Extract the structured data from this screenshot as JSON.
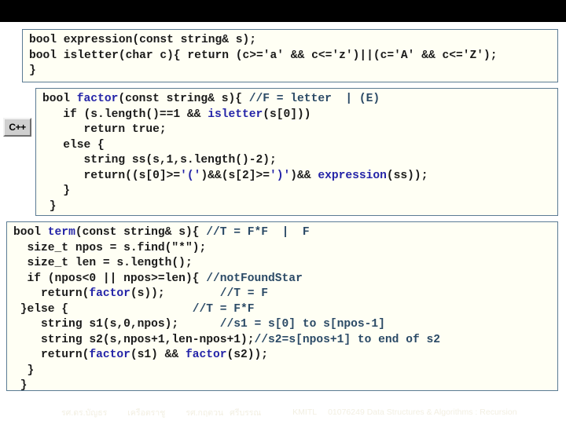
{
  "slide": {
    "badge_label": "C++",
    "boxes": [
      {
        "name": "expression-declarations",
        "lines": [
          [
            {
              "t": "bool expression(const string& s);",
              "c": "plain"
            }
          ],
          [
            {
              "t": "bool isletter(char c){ return (c>='a' && c<='z')||(c='A' && c<='Z');",
              "c": "plain"
            }
          ],
          [
            {
              "t": "}",
              "c": "plain"
            }
          ]
        ]
      },
      {
        "name": "factor-function",
        "lines": [
          [
            {
              "t": "bool ",
              "c": "plain"
            },
            {
              "t": "factor",
              "c": "fn"
            },
            {
              "t": "(const string& s){ ",
              "c": "plain"
            },
            {
              "t": "//F = letter  | (E)",
              "c": "cmt"
            }
          ],
          [
            {
              "t": "   if (s.length()==1 && ",
              "c": "plain"
            },
            {
              "t": "isletter",
              "c": "fn"
            },
            {
              "t": "(s[0]))",
              "c": "plain"
            }
          ],
          [
            {
              "t": "      return true;",
              "c": "plain"
            }
          ],
          [
            {
              "t": "   else {",
              "c": "plain"
            }
          ],
          [
            {
              "t": "      string ss(s,1,s.length()-2);",
              "c": "plain"
            }
          ],
          [
            {
              "t": "      return((s[0]>=",
              "c": "plain"
            },
            {
              "t": "'('",
              "c": "lit"
            },
            {
              "t": ")&&(s[2]>=",
              "c": "plain"
            },
            {
              "t": "')'",
              "c": "lit"
            },
            {
              "t": ")&& ",
              "c": "plain"
            },
            {
              "t": "expression",
              "c": "fn"
            },
            {
              "t": "(ss));",
              "c": "plain"
            }
          ],
          [
            {
              "t": "   }",
              "c": "plain"
            }
          ],
          [
            {
              "t": " }",
              "c": "plain"
            }
          ]
        ]
      },
      {
        "name": "term-function",
        "lines": [
          [
            {
              "t": "bool ",
              "c": "plain"
            },
            {
              "t": "term",
              "c": "fn"
            },
            {
              "t": "(const string& s){ ",
              "c": "plain"
            },
            {
              "t": "//T = F*F  |  F",
              "c": "cmt"
            }
          ],
          [
            {
              "t": "  size_t npos = s.find(\"*\");",
              "c": "plain"
            }
          ],
          [
            {
              "t": "  size_t len = s.length();",
              "c": "plain"
            }
          ],
          [
            {
              "t": "  if (npos<0 || npos>=len){ ",
              "c": "plain"
            },
            {
              "t": "//notFoundStar",
              "c": "cmt"
            }
          ],
          [
            {
              "t": "    return(",
              "c": "plain"
            },
            {
              "t": "factor",
              "c": "fn"
            },
            {
              "t": "(s));",
              "c": "plain"
            },
            {
              "t": "        ",
              "c": "plain"
            },
            {
              "t": "//T = F",
              "c": "cmt"
            }
          ],
          [
            {
              "t": " }else {",
              "c": "plain"
            },
            {
              "t": "                  ",
              "c": "plain"
            },
            {
              "t": "//T = F*F",
              "c": "cmt"
            }
          ],
          [
            {
              "t": "    string s1(s,0,npos);",
              "c": "plain"
            },
            {
              "t": "      ",
              "c": "plain"
            },
            {
              "t": "//s1 = s[0] to s[npos-1]",
              "c": "cmt"
            }
          ],
          [
            {
              "t": "    string s2(s,npos+1,len-npos+1);",
              "c": "plain"
            },
            {
              "t": "//s2=s[npos+1] to end of s2",
              "c": "cmt"
            }
          ],
          [
            {
              "t": "    return(",
              "c": "plain"
            },
            {
              "t": "factor",
              "c": "fn"
            },
            {
              "t": "(s1) && ",
              "c": "plain"
            },
            {
              "t": "factor",
              "c": "fn"
            },
            {
              "t": "(s2));",
              "c": "plain"
            }
          ],
          [
            {
              "t": "  }",
              "c": "plain"
            }
          ],
          [
            {
              "t": " }",
              "c": "plain"
            }
          ]
        ]
      }
    ],
    "footer": {
      "author1": "รศ.ดร.บัญธร",
      "author2": "เครือตราชู",
      "author3": "รศ.กฤตวน",
      "author4": "ศรีบรรณ",
      "org": "KMITL",
      "course": "01076249 Data Structures & Algorithms : Recursion"
    },
    "colors": {
      "box_border": "#5b7b94",
      "box_background": "#fffff4",
      "code_text": "#1a1a1a",
      "function_name": "#2424a8",
      "comment": "#2b4a66",
      "top_band": "#000000",
      "footer_text": "#f2efe2"
    }
  }
}
